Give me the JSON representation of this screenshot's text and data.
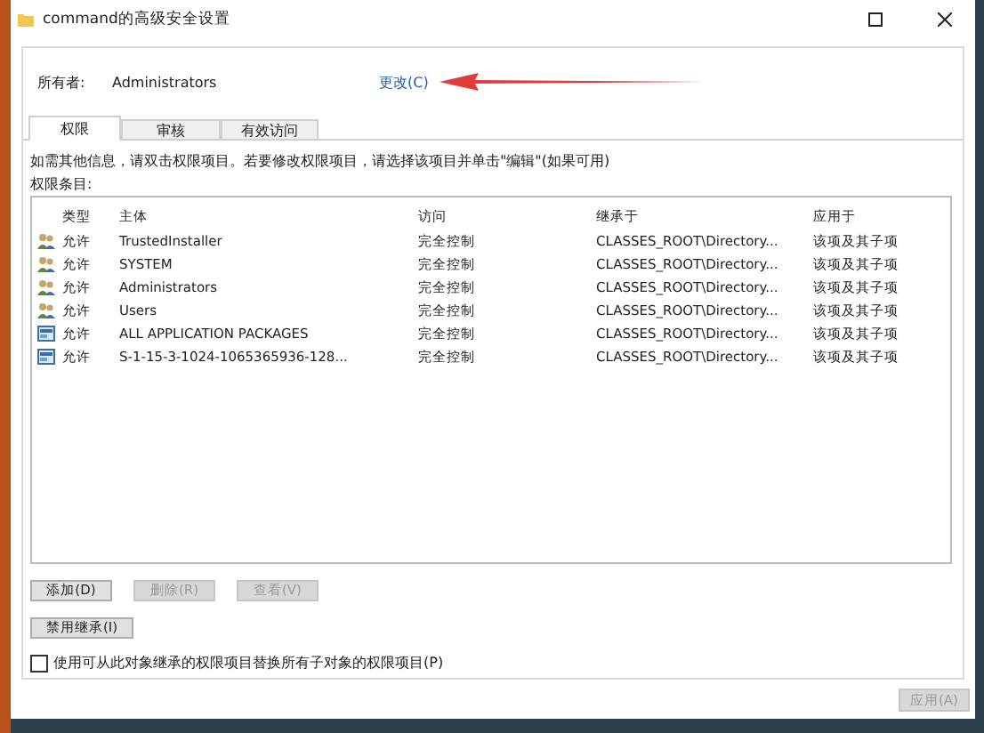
{
  "window": {
    "title": "command的高级安全设置"
  },
  "owner": {
    "label": "所有者:",
    "value": "Administrators",
    "change_link": "更改(C)"
  },
  "tabs": [
    {
      "label": "权限",
      "selected": true
    },
    {
      "label": "审核",
      "selected": false
    },
    {
      "label": "有效访问",
      "selected": false
    }
  ],
  "info_text": "如需其他信息，请双击权限项目。若要修改权限项目，请选择该项目并单击\"编辑\"(如果可用)",
  "entries_label": "权限条目:",
  "table": {
    "columns": [
      "类型",
      "主体",
      "访问",
      "继承于",
      "应用于"
    ],
    "rows": [
      {
        "kind": "group",
        "type": "允许",
        "principal": "TrustedInstaller",
        "access": "完全控制",
        "inherited_from": "CLASSES_ROOT\\Directory...",
        "applies_to": "该项及其子项"
      },
      {
        "kind": "group",
        "type": "允许",
        "principal": "SYSTEM",
        "access": "完全控制",
        "inherited_from": "CLASSES_ROOT\\Directory...",
        "applies_to": "该项及其子项"
      },
      {
        "kind": "group",
        "type": "允许",
        "principal": "Administrators",
        "access": "完全控制",
        "inherited_from": "CLASSES_ROOT\\Directory...",
        "applies_to": "该项及其子项"
      },
      {
        "kind": "group",
        "type": "允许",
        "principal": "Users",
        "access": "完全控制",
        "inherited_from": "CLASSES_ROOT\\Directory...",
        "applies_to": "该项及其子项"
      },
      {
        "kind": "package",
        "type": "允许",
        "principal": "ALL APPLICATION PACKAGES",
        "access": "完全控制",
        "inherited_from": "CLASSES_ROOT\\Directory...",
        "applies_to": "该项及其子项"
      },
      {
        "kind": "package",
        "type": "允许",
        "principal": "S-1-15-3-1024-1065365936-128...",
        "access": "完全控制",
        "inherited_from": "CLASSES_ROOT\\Directory...",
        "applies_to": "该项及其子项"
      }
    ]
  },
  "action_buttons": [
    {
      "label": "添加(D)",
      "disabled": false
    },
    {
      "label": "删除(R)",
      "disabled": true
    },
    {
      "label": "查看(V)",
      "disabled": true
    }
  ],
  "inheritance_button": {
    "label": "禁用继承(I)"
  },
  "replace_checkbox": {
    "label": "使用可从此对象继承的权限项目替换所有子对象的权限项目(P)",
    "checked": false
  },
  "footer_buttons": [
    {
      "label": "应用(A)",
      "disabled": true
    }
  ]
}
